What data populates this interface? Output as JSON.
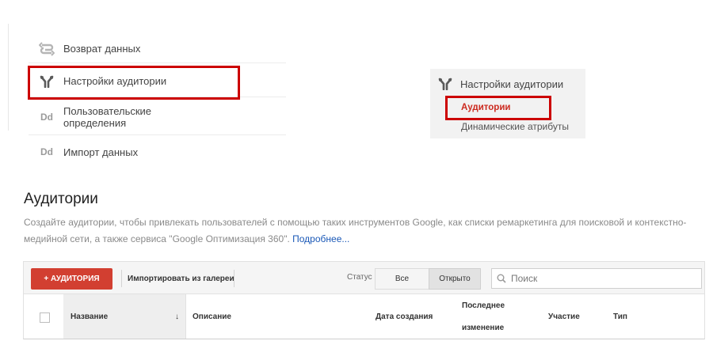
{
  "nav": {
    "items": [
      {
        "label": "Возврат данных",
        "icon": "data-return-icon"
      },
      {
        "label": "Настройки аудитории",
        "icon": "audience-settings-icon"
      },
      {
        "label_line1": "Пользовательские",
        "label_line2": "определения",
        "icon_text": "Dd"
      },
      {
        "label": "Импорт данных",
        "icon_text": "Dd"
      }
    ]
  },
  "submenu": {
    "header": "Настройки аудитории",
    "items": [
      "Аудитории",
      "Динамические атрибуты"
    ]
  },
  "page": {
    "title": "Аудитории",
    "description": "Создайте аудитории, чтобы привлекать пользователей с помощью таких инструментов Google, как списки ремаркетинга для поисковой и контекстно-медийной сети, а также сервиса \"Google Оптимизация 360\".",
    "more_link": "Подробнее..."
  },
  "toolbar": {
    "add_label": "+ АУДИТОРИЯ",
    "import_label": "Импортировать из галереи",
    "status_label": "Статус",
    "filter_all": "Все",
    "filter_open": "Открыто",
    "search_placeholder": "Поиск"
  },
  "table": {
    "columns": {
      "name": "Название",
      "sort_indicator": "↓",
      "description": "Описание",
      "created": "Дата создания",
      "modified_line1": "Последнее",
      "modified_line2": "изменение",
      "participation": "Участие",
      "type": "Тип"
    }
  },
  "colors": {
    "highlight": "#cc0000",
    "primary_button": "#d23f31",
    "active_link": "#cc2a1f",
    "link": "#1a58b7"
  }
}
